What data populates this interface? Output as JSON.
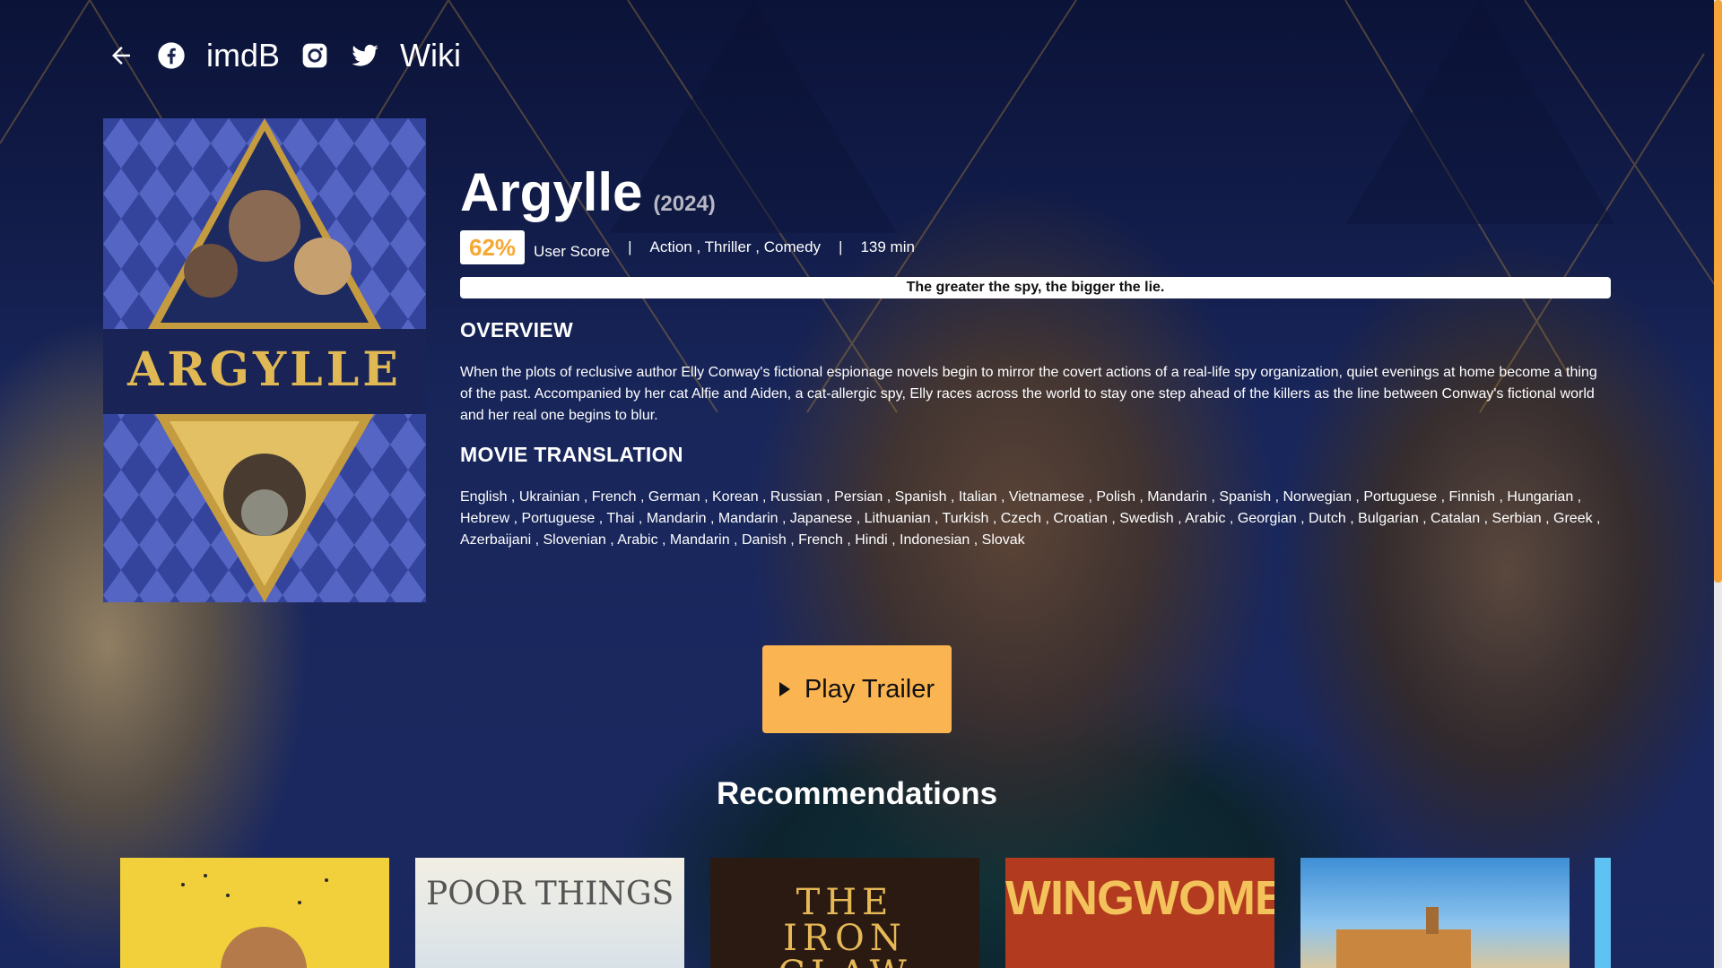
{
  "nav": {
    "back_icon": "arrow-left-icon",
    "facebook_icon": "facebook-icon",
    "imdb_label": "imdB",
    "instagram_icon": "instagram-icon",
    "twitter_icon": "twitter-icon",
    "wiki_label": "Wiki"
  },
  "movie": {
    "title": "Argylle",
    "year": "(2024)",
    "user_score": "62%",
    "user_score_label": "User Score",
    "separator": "|",
    "genres": "Action , Thriller , Comedy",
    "runtime": "139 min",
    "tagline": "The greater the spy, the bigger the lie.",
    "poster_text": "ARGYLLE"
  },
  "overview": {
    "heading": "OVERVIEW",
    "text": "When the plots of reclusive author Elly Conway's fictional espionage novels begin to mirror the covert actions of a real-life spy organization, quiet evenings at home become a thing of the past. Accompanied by her cat Alfie and Aiden, a cat-allergic spy, Elly races across the world to stay one step ahead of the killers as the line between Conway's fictional world and her real one begins to blur."
  },
  "translation": {
    "heading": "MOVIE TRANSLATION",
    "languages": "English , Ukrainian , French , German , Korean , Russian , Persian , Spanish , Italian , Vietnamese , Polish , Mandarin , Spanish , Norwegian , Portuguese , Finnish , Hungarian , Hebrew , Portuguese , Thai , Mandarin , Mandarin , Japanese , Lithuanian , Turkish , Czech , Croatian , Swedish , Arabic , Georgian , Dutch , Bulgarian , Catalan , Serbian , Greek , Azerbaijani , Slovenian , Arabic , Mandarin , Danish , French , Hindi , Indonesian , Slovak"
  },
  "trailer": {
    "label": "Play Trailer",
    "icon": "play-icon"
  },
  "recommendations": {
    "heading": "Recommendations",
    "cards": [
      {
        "title": ""
      },
      {
        "title": "POOR THINGS"
      },
      {
        "title": "THE IRON CLAW"
      },
      {
        "title": "WINGWOMEN"
      },
      {
        "title": ""
      }
    ]
  },
  "colors": {
    "accent": "#fbb452",
    "score": "#f7a733",
    "scroll_thumb": "#f4a43a"
  }
}
